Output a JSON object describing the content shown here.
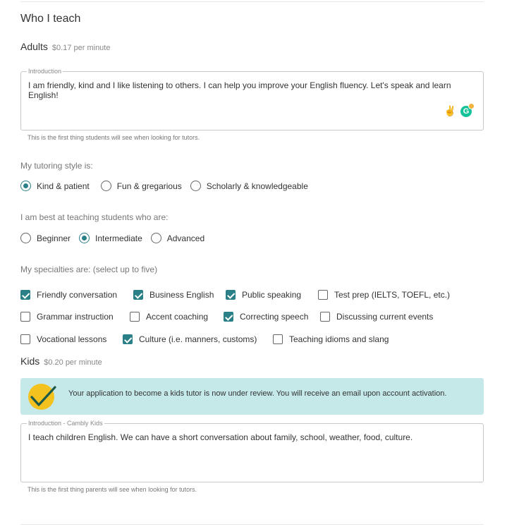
{
  "section_title": "Who I teach",
  "adults": {
    "label": "Adults",
    "price": "$0.17 per minute",
    "intro_legend": "Introduction",
    "intro_text": "I am friendly, kind and I like listening to others. I can help you improve your English fluency. Let's speak and learn English!",
    "helper": "This is the first thing students will see when looking for tutors."
  },
  "style": {
    "label": "My tutoring style is:",
    "options": [
      {
        "label": "Kind & patient",
        "selected": true
      },
      {
        "label": "Fun & gregarious",
        "selected": false
      },
      {
        "label": "Scholarly & knowledgeable",
        "selected": false
      }
    ]
  },
  "level": {
    "label": "I am best at teaching students who are:",
    "options": [
      {
        "label": "Beginner",
        "selected": false
      },
      {
        "label": "Intermediate",
        "selected": true
      },
      {
        "label": "Advanced",
        "selected": false
      }
    ]
  },
  "specialties": {
    "label": "My specialties are: (select up to five)",
    "items": [
      {
        "label": "Friendly conversation",
        "checked": true
      },
      {
        "label": "Business English",
        "checked": true
      },
      {
        "label": "Public speaking",
        "checked": true
      },
      {
        "label": "Test prep (IELTS, TOEFL, etc.)",
        "checked": false
      },
      {
        "label": "Grammar instruction",
        "checked": false
      },
      {
        "label": "Accent coaching",
        "checked": false
      },
      {
        "label": "Correcting speech",
        "checked": true
      },
      {
        "label": "Discussing current events",
        "checked": false
      },
      {
        "label": "Vocational lessons",
        "checked": false
      },
      {
        "label": "Culture (i.e. manners, customs)",
        "checked": true
      },
      {
        "label": "Teaching idioms and slang",
        "checked": false
      }
    ]
  },
  "kids": {
    "label": "Kids",
    "price": "$0.20 per minute",
    "banner": "Your application to become a kids tutor is now under review. You will receive an email upon account activation.",
    "intro_legend": "Introduction - Cambly Kids",
    "intro_text": "I teach children English. We can have a short conversation about family, school, weather, food, culture.",
    "helper": "This is the first thing parents will see when looking for tutors."
  },
  "icons": {
    "emoji": "victory-hand-emoji",
    "grammarly": "grammarly-icon",
    "review": "checkmark-icon"
  },
  "colors": {
    "accent": "#2b7f86",
    "banner_bg": "#c5e8e9",
    "badge": "#f4c21f"
  }
}
